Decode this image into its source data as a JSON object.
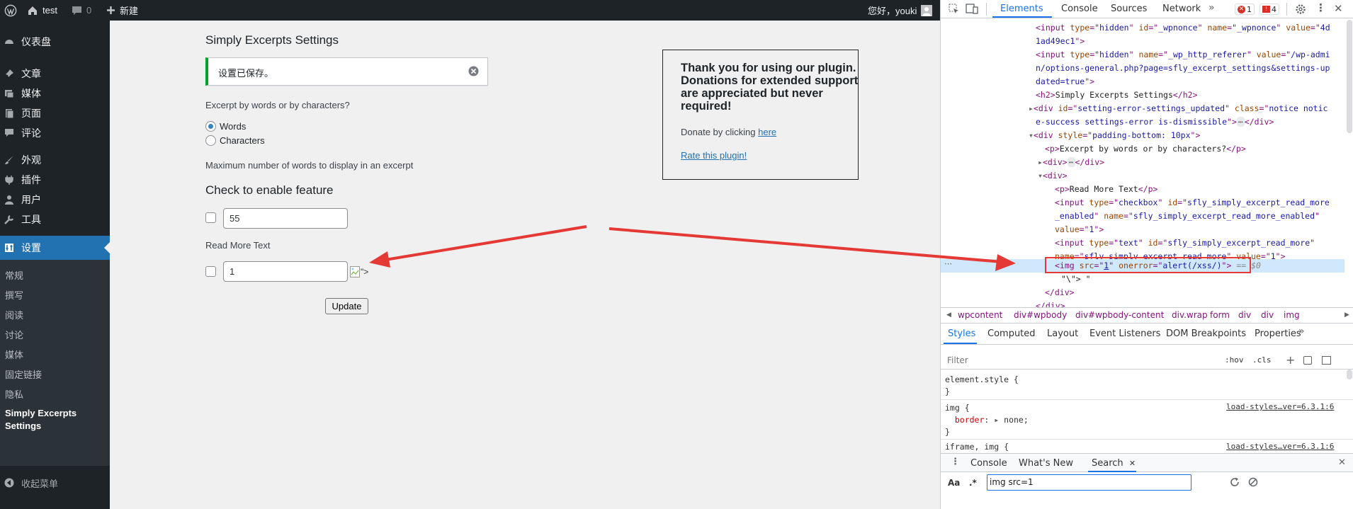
{
  "adminbar": {
    "site_name": "test",
    "comments_count": "0",
    "new_label": "新建",
    "greeting": "您好，youki"
  },
  "sidebar": {
    "items": [
      {
        "label": "仪表盘",
        "icon": "dashboard-icon"
      },
      {
        "label": "文章",
        "icon": "pin-icon"
      },
      {
        "label": "媒体",
        "icon": "media-icon"
      },
      {
        "label": "页面",
        "icon": "page-icon"
      },
      {
        "label": "评论",
        "icon": "comment-icon"
      },
      {
        "label": "外观",
        "icon": "brush-icon"
      },
      {
        "label": "插件",
        "icon": "plug-icon"
      },
      {
        "label": "用户",
        "icon": "user-icon"
      },
      {
        "label": "工具",
        "icon": "wrench-icon"
      },
      {
        "label": "设置",
        "icon": "settings-icon"
      }
    ],
    "submenu": [
      "常规",
      "撰写",
      "阅读",
      "讨论",
      "媒体",
      "固定链接",
      "隐私",
      "Simply Excerpts Settings"
    ],
    "collapse_label": "收起菜单"
  },
  "page": {
    "title": "Simply Excerpts Settings",
    "notice": "设置已保存。",
    "excerpt_question": "Excerpt by words or by characters?",
    "radio_words": "Words",
    "radio_characters": "Characters",
    "max_words_label": "Maximum number of words to display in an excerpt",
    "feature_heading": "Check to enable feature",
    "max_words_value": "55",
    "read_more_label": "Read More Text",
    "read_more_value": "1",
    "broken_img_text": "\">",
    "update_button": "Update"
  },
  "donate_box": {
    "heading": "Thank you for using our plugin. Donations for extended support are appreciated but never required!",
    "donate_prefix": "Donate by clicking ",
    "donate_link": "here",
    "rate_link": "Rate this plugin!"
  },
  "devtools": {
    "tabs": [
      "Elements",
      "Console",
      "Sources",
      "Network"
    ],
    "errors_count": "1",
    "issues_count": "4",
    "breadcrumbs": [
      "wpcontent",
      "div#wpbody",
      "div#wpbody-content",
      "div.wrap",
      "form",
      "div",
      "div",
      "img"
    ],
    "styles_tabs": [
      "Styles",
      "Computed",
      "Layout",
      "Event Listeners",
      "DOM Breakpoints",
      "Properties"
    ],
    "filter_placeholder": "Filter",
    "hov_label": ":hov",
    "cls_label": ".cls",
    "rule1_selector": "element.style {",
    "rule2_selector": "img {",
    "rule2_source": "load-styles…ver=6.3.1:6",
    "rule2_prop": "border",
    "rule2_value": "none;",
    "rule3_selector": "iframe, img {",
    "rule3_source": "load-styles…ver=6.3.1:6",
    "drawer_tabs": [
      "Console",
      "What's New",
      "Search"
    ],
    "search_case_label": "Aa",
    "search_regex_label": ".*",
    "search_value": "img src=1",
    "selected_marker": "== $0"
  },
  "colors": {
    "wp_dark": "#1d2327",
    "wp_blue": "#2271b1",
    "notice_green": "#00a32a",
    "arrow_red": "#e53935"
  }
}
